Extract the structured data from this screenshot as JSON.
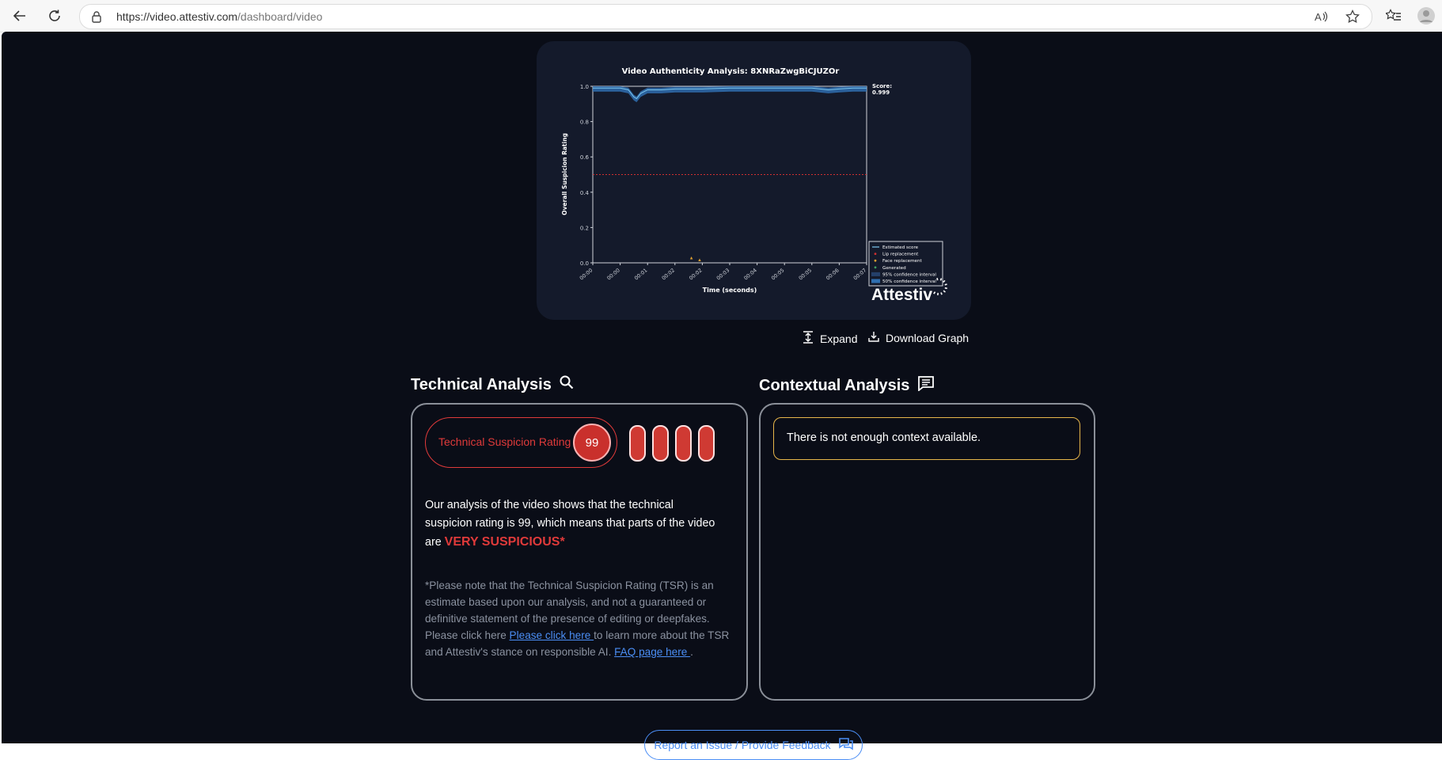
{
  "browser": {
    "url_host": "https://video.attestiv.com",
    "url_path": "/dashboard/video"
  },
  "chart_data": {
    "type": "line",
    "title": "Video Authenticity Analysis: 8XNRaZwgBiCJUZOr",
    "xlabel": "Time (seconds)",
    "ylabel": "Overall Suspicion Rating",
    "ylim": [
      0,
      1
    ],
    "y_ticks": [
      "0.0",
      "0.2",
      "0.4",
      "0.6",
      "0.8",
      "1.0"
    ],
    "x_ticks": [
      "00:00",
      "00:00",
      "00:01",
      "00:02",
      "00:02",
      "00:03",
      "00:04",
      "00:05",
      "00:05",
      "00:06",
      "00:07"
    ],
    "threshold": 0.5,
    "score_label": "Score:",
    "score_value": "0.999",
    "series": [
      {
        "name": "Estimated score",
        "x": [
          0,
          0.5,
          1,
          1.3,
          1.5,
          1.6,
          1.75,
          2,
          2.5,
          3,
          4,
          5,
          6,
          7,
          8,
          8.6,
          9,
          9.5,
          10
        ],
        "values": [
          0.99,
          0.99,
          0.99,
          0.98,
          0.94,
          0.93,
          0.96,
          0.98,
          0.98,
          0.985,
          0.985,
          0.99,
          0.99,
          0.99,
          0.99,
          0.98,
          0.985,
          0.99,
          0.99
        ]
      }
    ],
    "markers": [
      {
        "name": "Face replacement",
        "x": 3.6,
        "y": 0.02
      },
      {
        "name": "Generated",
        "x": 3.9,
        "y": 0.01
      }
    ],
    "legend": [
      "Estimated score",
      "Lip replacement",
      "Face replacement",
      "Generated",
      "95% confidence interval",
      "50% confidence interval"
    ],
    "legend_position": "lower-right outside",
    "brand": "Attestiv"
  },
  "actions": {
    "expand": "Expand",
    "download": "Download Graph"
  },
  "technical": {
    "title": "Technical Analysis",
    "rating_label": "Technical Suspicion Rating",
    "rating_value": "99",
    "analysis_prefix": "Our analysis of the video shows that the technical suspicion rating is 99, which means that parts of the video are ",
    "verdict": "VERY SUSPICIOUS*",
    "note_prefix": "*Please note that the Technical Suspicion Rating (TSR) is an estimate based upon our analysis, and not a guaranteed or definitive statement of the presence of editing or deepfakes. Please click here ",
    "link1": "Please click here ",
    "note_middle": " to learn more about the TSR and Attestiv's stance on responsible AI. ",
    "link2": "FAQ page here ",
    "note_suffix": "."
  },
  "contextual": {
    "title": "Contextual Analysis",
    "message": "There is not enough context available."
  },
  "feedback": {
    "label": "Report an Issue / Provide Feedback"
  },
  "colors": {
    "page_bg": "#0a0d17",
    "card_bg": "#141a2b",
    "danger": "#e03a3a",
    "link": "#4b8ef5",
    "warning_border": "#e6b64a",
    "series": "#3fa7e0"
  }
}
